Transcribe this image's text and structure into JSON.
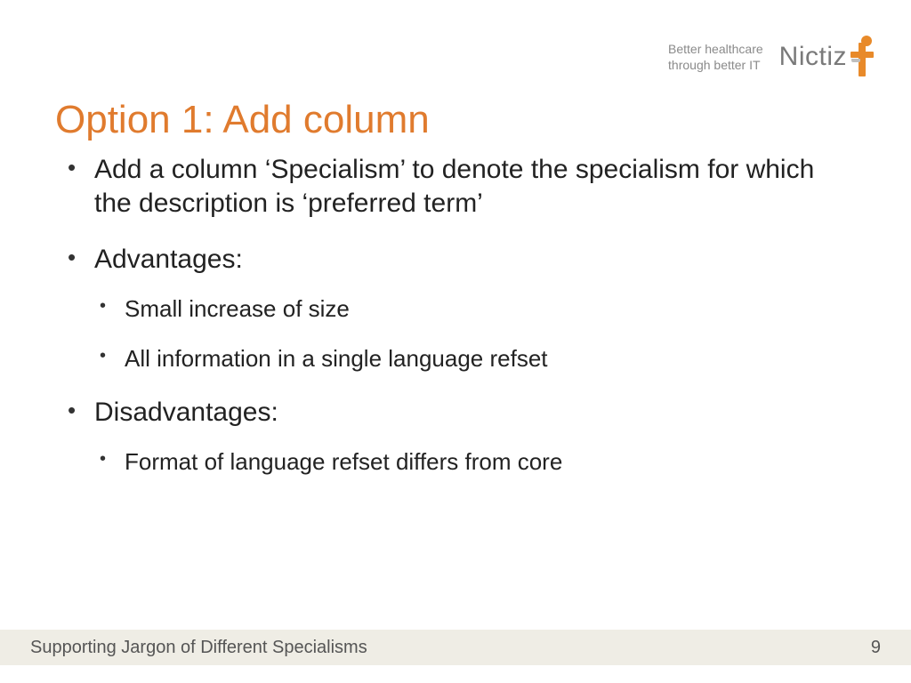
{
  "header": {
    "tagline_l1": "Better healthcare",
    "tagline_l2": "through better IT",
    "logo_text": "Nictiz"
  },
  "title": "Option 1: Add column",
  "bullets": {
    "b1": "Add a column ‘Specialism’ to denote the specialism for which the description is ‘preferred term’",
    "b2": "Advantages:",
    "b2_sub1": "Small increase of size",
    "b2_sub2": "All information in a single language refset",
    "b3": "Disadvantages:",
    "b3_sub1": "Format of language refset differs from core"
  },
  "footer": {
    "left": "Supporting Jargon of Different Specialisms",
    "right": "9"
  }
}
